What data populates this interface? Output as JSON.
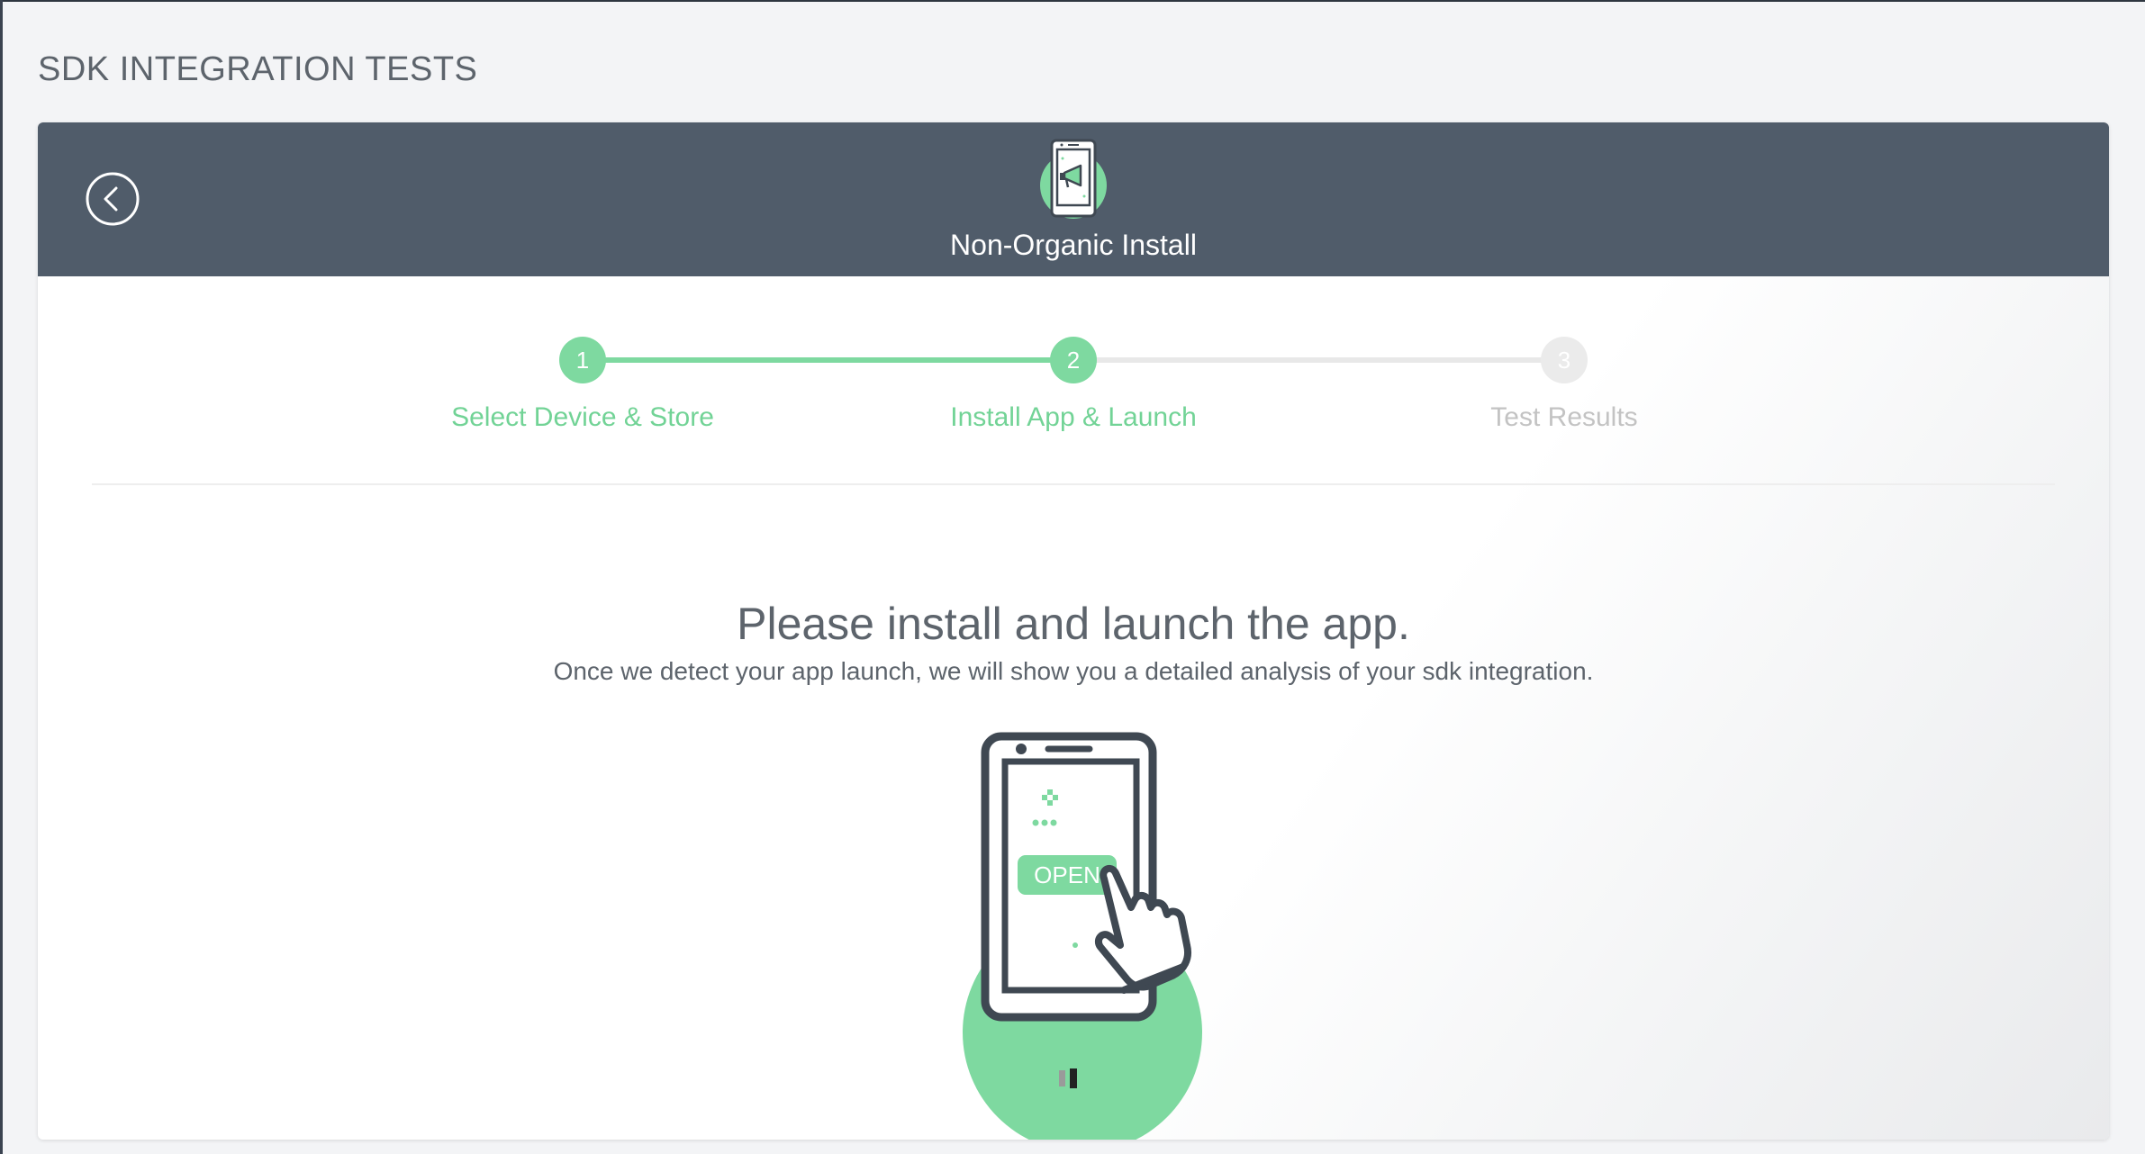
{
  "page": {
    "title": "SDK INTEGRATION TESTS"
  },
  "header": {
    "title": "Non-Organic Install",
    "icon": "phone-megaphone-icon",
    "back_icon": "chevron-left-circle-icon"
  },
  "stepper": {
    "steps": [
      {
        "number": "1",
        "label": "Select Device & Store",
        "state": "complete"
      },
      {
        "number": "2",
        "label": "Install App & Launch",
        "state": "active"
      },
      {
        "number": "3",
        "label": "Test Results",
        "state": "pending"
      }
    ]
  },
  "main": {
    "heading": "Please install and launch the app.",
    "subheading": "Once we detect your app launch, we will show you a detailed analysis of your sdk integration.",
    "illustration": {
      "icon": "phone-tap-open-icon",
      "button_text": "OPEN"
    },
    "loader_icon": "loading-spinner-icon"
  },
  "colors": {
    "header_bg": "#505c6a",
    "accent_green": "#7ed9a0",
    "inactive_gray": "#ebebeb",
    "text_gray": "#5d646c"
  }
}
